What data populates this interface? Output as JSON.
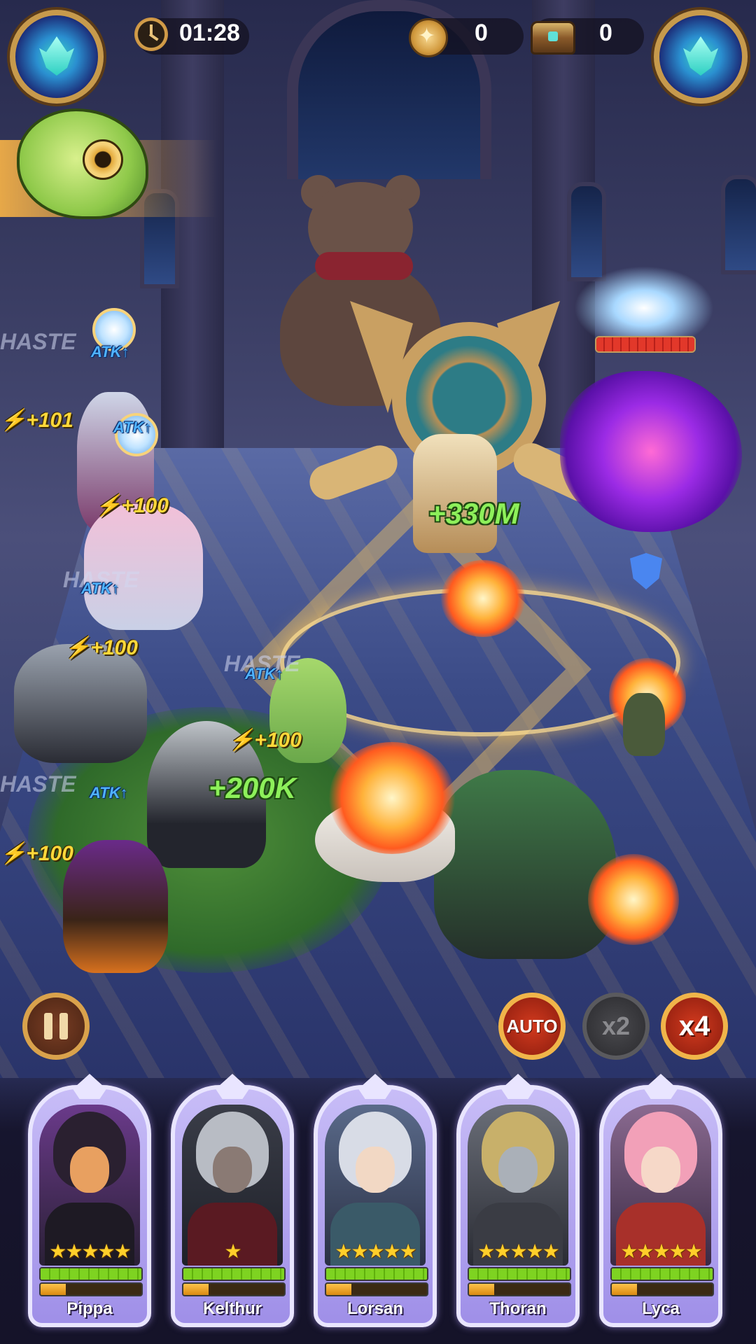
{
  "hud": {
    "timer": "01:28",
    "coins": "0",
    "chests": "0"
  },
  "floating_text": {
    "haste": "HASTE",
    "atk_buff": "ATK↑",
    "energy_101": "⚡+101",
    "energy_100": "⚡+100",
    "heal_boss": "+330M",
    "heal_team": "+200K"
  },
  "boss": {
    "hp_fraction": 1.0
  },
  "controls": {
    "auto_label": "AUTO",
    "x2_label": "x2",
    "x4_label": "x4"
  },
  "heroes": [
    {
      "name": "Pippa",
      "stars": "★★★★★",
      "hp": 1.0,
      "energy": 0.25
    },
    {
      "name": "Kelthur",
      "stars": "★",
      "hp": 1.0,
      "energy": 0.25
    },
    {
      "name": "Lorsan",
      "stars": "★★★★★",
      "hp": 1.0,
      "energy": 0.25
    },
    {
      "name": "Thoran",
      "stars": "★★★★★",
      "hp": 1.0,
      "energy": 0.25
    },
    {
      "name": "Lyca",
      "stars": "★★★★★",
      "hp": 1.0,
      "energy": 0.25
    }
  ],
  "colors": {
    "gold": "#d9a24c",
    "energy_text": "#ffd83a",
    "heal_text": "#8df05a",
    "atk_text": "#4fb2ff",
    "card_frame": "#e9e5ff"
  }
}
